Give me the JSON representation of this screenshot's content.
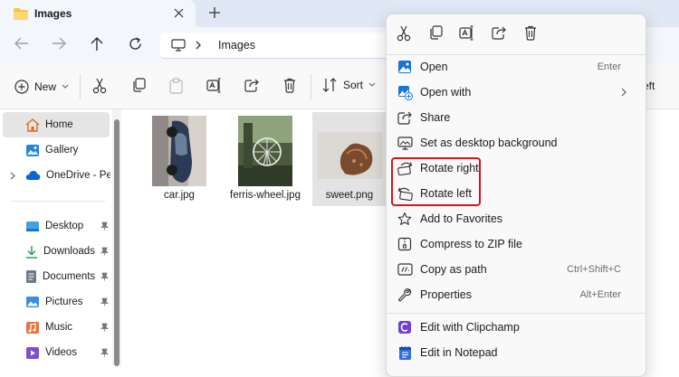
{
  "tab": {
    "title": "Images"
  },
  "address": {
    "location": "Images"
  },
  "toolbar": {
    "new_label": "New",
    "sort_label": "Sort",
    "cut_off_label": "eft"
  },
  "sidebar": {
    "items": [
      {
        "label": "Home"
      },
      {
        "label": "Gallery"
      },
      {
        "label": "OneDrive - Perso"
      },
      {
        "label": "Desktop"
      },
      {
        "label": "Downloads"
      },
      {
        "label": "Documents"
      },
      {
        "label": "Pictures"
      },
      {
        "label": "Music"
      },
      {
        "label": "Videos"
      }
    ]
  },
  "files": [
    {
      "name": "car.jpg"
    },
    {
      "name": "ferris-wheel.jpg"
    },
    {
      "name": "sweet.png"
    }
  ],
  "context_menu": {
    "items": [
      {
        "label": "Open",
        "shortcut": "Enter"
      },
      {
        "label": "Open with",
        "shortcut": ""
      },
      {
        "label": "Share",
        "shortcut": ""
      },
      {
        "label": "Set as desktop background",
        "shortcut": ""
      },
      {
        "label": "Rotate right",
        "shortcut": ""
      },
      {
        "label": "Rotate left",
        "shortcut": ""
      },
      {
        "label": "Add to Favorites",
        "shortcut": ""
      },
      {
        "label": "Compress to ZIP file",
        "shortcut": ""
      },
      {
        "label": "Copy as path",
        "shortcut": "Ctrl+Shift+C"
      },
      {
        "label": "Properties",
        "shortcut": "Alt+Enter"
      },
      {
        "label": "Edit with Clipchamp",
        "shortcut": ""
      },
      {
        "label": "Edit in Notepad",
        "shortcut": ""
      }
    ]
  },
  "colors": {
    "accent": "#0067c0",
    "highlight": "#d4161c",
    "folder": "#f5c542"
  }
}
